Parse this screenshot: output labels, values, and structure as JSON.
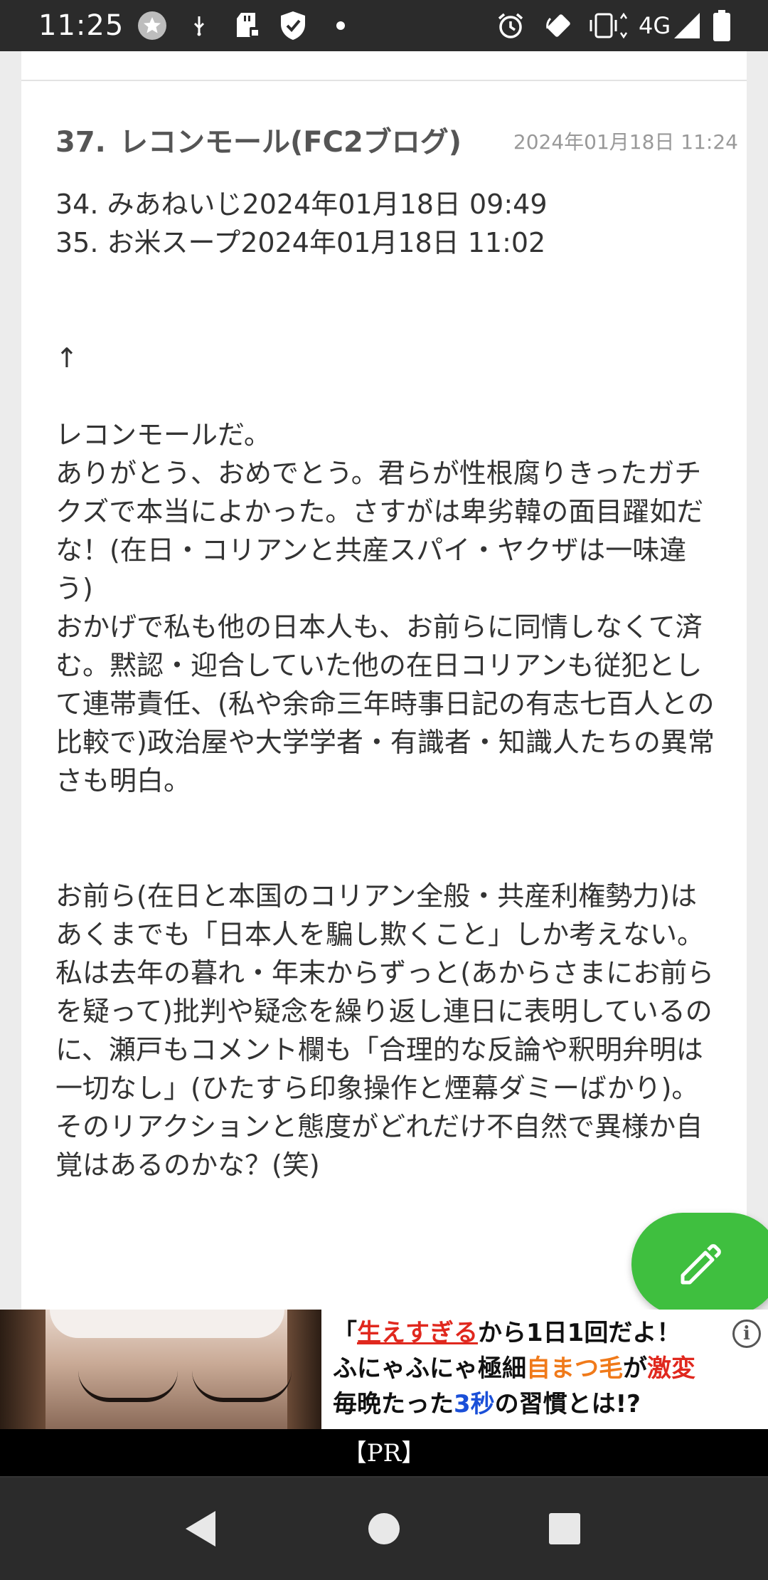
{
  "status_bar": {
    "time": "11:25",
    "network": "4G",
    "icons": [
      "star-badge-icon",
      "usb-icon",
      "sd-card-icon",
      "shield-icon",
      "dot-icon",
      "alarm-icon",
      "rotate-icon",
      "vibrate-icon",
      "signal-icon",
      "battery-icon"
    ]
  },
  "comment": {
    "number": "37.",
    "author": "レコンモール(FC2ブログ)",
    "date": "2024年01月18日 11:24",
    "body": [
      "34. みあねいじ2024年01月18日 09:49\n35. お米スープ2024年01月18日 11:02",
      "↑",
      "レコンモールだ。\nありがとう、おめでとう。君らが性根腐りきったガチクズで本当によかった。さすがは卑劣韓の面目躍如だな！(在日・コリアンと共産スパイ・ヤクザは一味違う)\nおかげで私も他の日本人も、お前らに同情しなくて済む。黙認・迎合していた他の在日コリアンも従犯として連帯責任、(私や余命三年時事日記の有志七百人との比較で)政治屋や大学学者・有識者・知識人たちの異常さも明白。",
      "お前ら(在日と本国のコリアン全般・共産利権勢力)はあくまでも「日本人を騙し欺くこと」しか考えない。\n私は去年の暮れ・年末からずっと(あからさまにお前らを疑って)批判や疑念を繰り返し連日に表明しているのに、瀬戸もコメント欄も「合理的な反論や釈明弁明は一切なし」(ひたすら印象操作と煙幕ダミーばかり)。そのリアクションと態度がどれだけ不自然で異様か自覚はあるのかな？(笑)"
    ]
  },
  "fab": {
    "icon": "pencil-icon"
  },
  "ad": {
    "line1_a": "「",
    "line1_b": "生えすぎる",
    "line1_c": "から1日1回だよ！",
    "line2_a": "ふにゃふにゃ極細",
    "line2_b": "自まつ毛",
    "line2_c": "が",
    "line2_d": "激変",
    "line3_a": "毎晩たった",
    "line3_b": "3秒",
    "line3_c": "の習慣とは!?",
    "info": "i",
    "pr_label": "【PR】"
  },
  "nav": {
    "back": "back-icon",
    "home": "home-icon",
    "recents": "recents-icon"
  }
}
